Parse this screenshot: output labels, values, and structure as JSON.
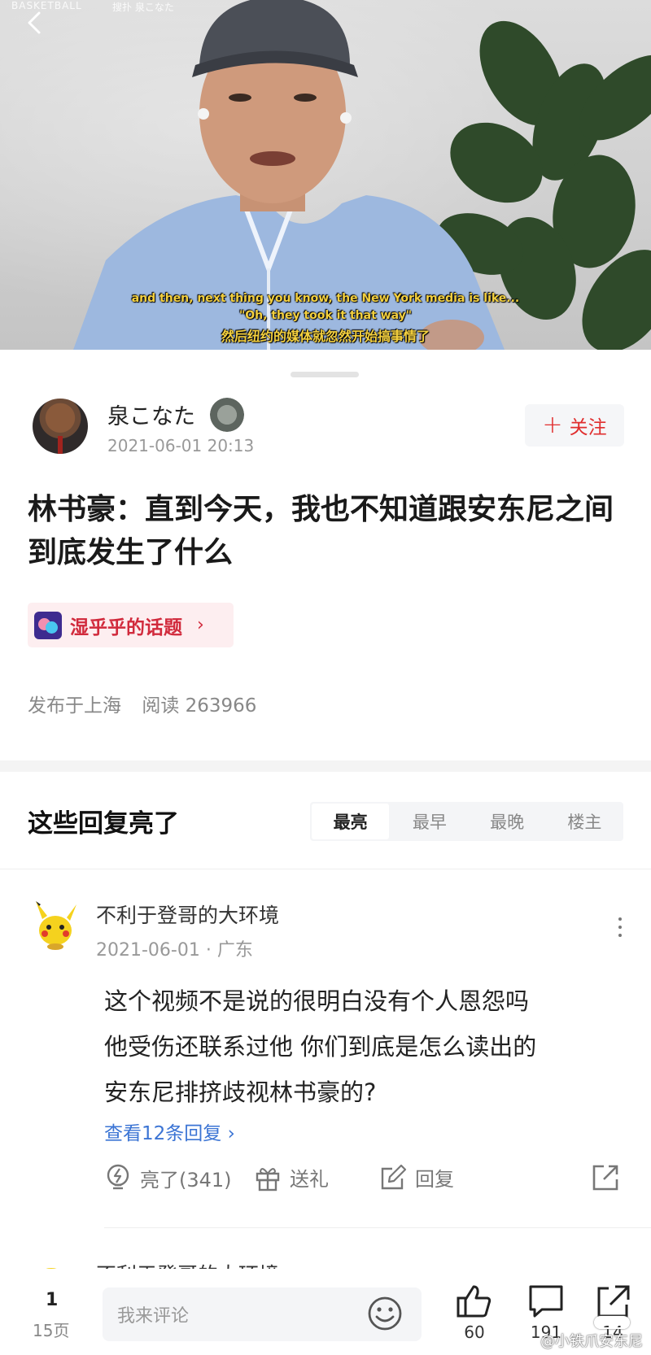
{
  "video": {
    "watermark_left": "BASKETBALL",
    "watermark_right": "搜扑 泉こなた",
    "subtitle_line1": "and then, next thing you know, the New York media is like...",
    "subtitle_line2": "\"Oh, they took it that way\"",
    "subtitle_line3": "然后纽约的媒体就忽然开始搞事情了"
  },
  "author": {
    "name": "泉こなた",
    "date": "2021-06-01 20:13",
    "follow_label": "关注"
  },
  "post": {
    "title": "林书豪：直到今天，我也不知道跟安东尼之间到底发生了什么",
    "topic": "湿乎乎的话题",
    "location": "发布于上海",
    "reads": "阅读 263966"
  },
  "replies": {
    "heading": "这些回复亮了",
    "sort_tabs": [
      "最亮",
      "最早",
      "最晚",
      "楼主"
    ],
    "active_tab": "最亮"
  },
  "comment": {
    "author": "不利于登哥的大环境",
    "date_location": "2021-06-01 · 广东",
    "body_lines": [
      "这个视频不是说的很明白没有个人恩怨吗",
      "他受伤还联系过他 你们到底是怎么读出的",
      "安东尼排挤歧视林书豪的?"
    ],
    "view_replies": "查看12条回复",
    "like_label": "亮了(341)",
    "gift_label": "送礼",
    "reply_label": "回复"
  },
  "next_comment_author": "不利于登哥的大环境",
  "bottom_bar": {
    "page_current": "1",
    "page_total": "15页",
    "input_placeholder": "我来评论",
    "like_count": "60",
    "comment_count": "191",
    "share_count": "14"
  },
  "source_watermark": "@小铁爪安东尼",
  "colors": {
    "accent_red": "#e02e2e",
    "topic_red": "#d12a3c",
    "link_blue": "#3b74d4"
  }
}
